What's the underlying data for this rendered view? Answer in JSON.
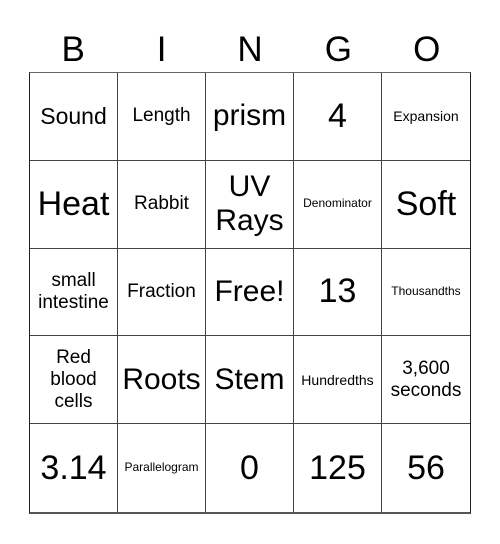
{
  "header": {
    "letters": [
      "B",
      "I",
      "N",
      "G",
      "O"
    ]
  },
  "board": {
    "rows": [
      [
        "Sound",
        "Length",
        "prism",
        "4",
        "Expansion"
      ],
      [
        "Heat",
        "Rabbit",
        "UV Rays",
        "Denominator",
        "Soft"
      ],
      [
        "small intestine",
        "Fraction",
        "Free!",
        "13",
        "Thousandths"
      ],
      [
        "Red blood cells",
        "Roots",
        "Stem",
        "Hundredths",
        "3,600 seconds"
      ],
      [
        "3.14",
        "Parallelogram",
        "0",
        "125",
        "56"
      ]
    ],
    "free_space": "Free!"
  }
}
